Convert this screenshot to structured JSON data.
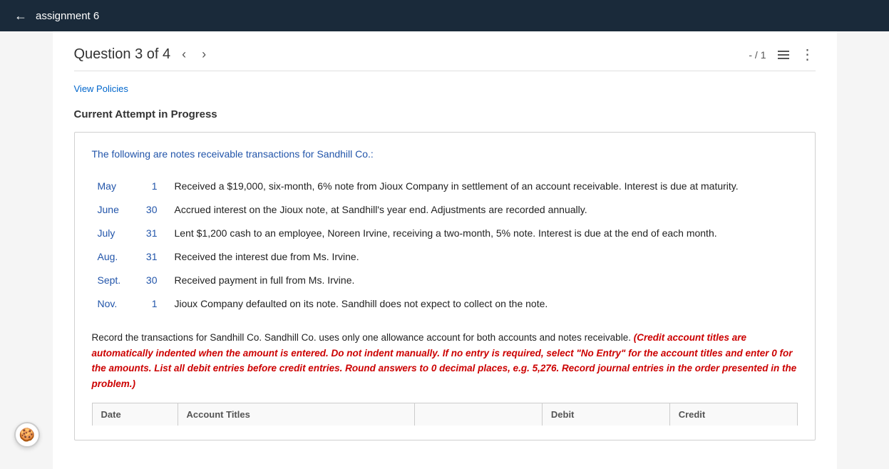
{
  "topbar": {
    "back_label": "←",
    "title": "assignment 6"
  },
  "question_header": {
    "label": "Question 3 of 4",
    "prev_btn": "‹",
    "next_btn": "›",
    "score": "- / 1",
    "list_icon": "list-icon",
    "more_icon": "⋮"
  },
  "view_policies_link": "View Policies",
  "attempt_status": "Current Attempt in Progress",
  "problem": {
    "intro": "The following are notes receivable transactions for Sandhill Co.:",
    "transactions": [
      {
        "month": "May",
        "day": "1",
        "description": "Received a $19,000, six-month, 6% note from Jioux Company in settlement of an account receivable. Interest is due at maturity."
      },
      {
        "month": "June",
        "day": "30",
        "description": "Accrued interest on the Jioux note, at Sandhill's year end. Adjustments are recorded annually."
      },
      {
        "month": "July",
        "day": "31",
        "description": "Lent $1,200 cash to an employee, Noreen Irvine, receiving a two-month, 5% note. Interest is due at the end of each month."
      },
      {
        "month": "Aug.",
        "day": "31",
        "description": "Received the interest due from Ms. Irvine."
      },
      {
        "month": "Sept.",
        "day": "30",
        "description": "Received payment in full from Ms. Irvine."
      },
      {
        "month": "Nov.",
        "day": "1",
        "description": "Jioux Company defaulted on its note. Sandhill does not expect to collect on the note."
      }
    ],
    "instructions_normal": "Record the transactions for Sandhill Co. Sandhill Co. uses only one allowance account for both accounts and notes receivable.",
    "instructions_red": "(Credit account titles are automatically indented when the amount is entered. Do not indent manually. If no entry is required, select \"No Entry\" for the account titles and enter 0 for the amounts. List all debit entries before credit entries. Round answers to 0 decimal places, e.g. 5,276. Record journal entries in the order presented in the problem.)"
  },
  "journal_table": {
    "columns": [
      "Date",
      "Account Titles",
      "",
      "Debit",
      "Credit"
    ]
  },
  "cookie_icon": "🍪"
}
